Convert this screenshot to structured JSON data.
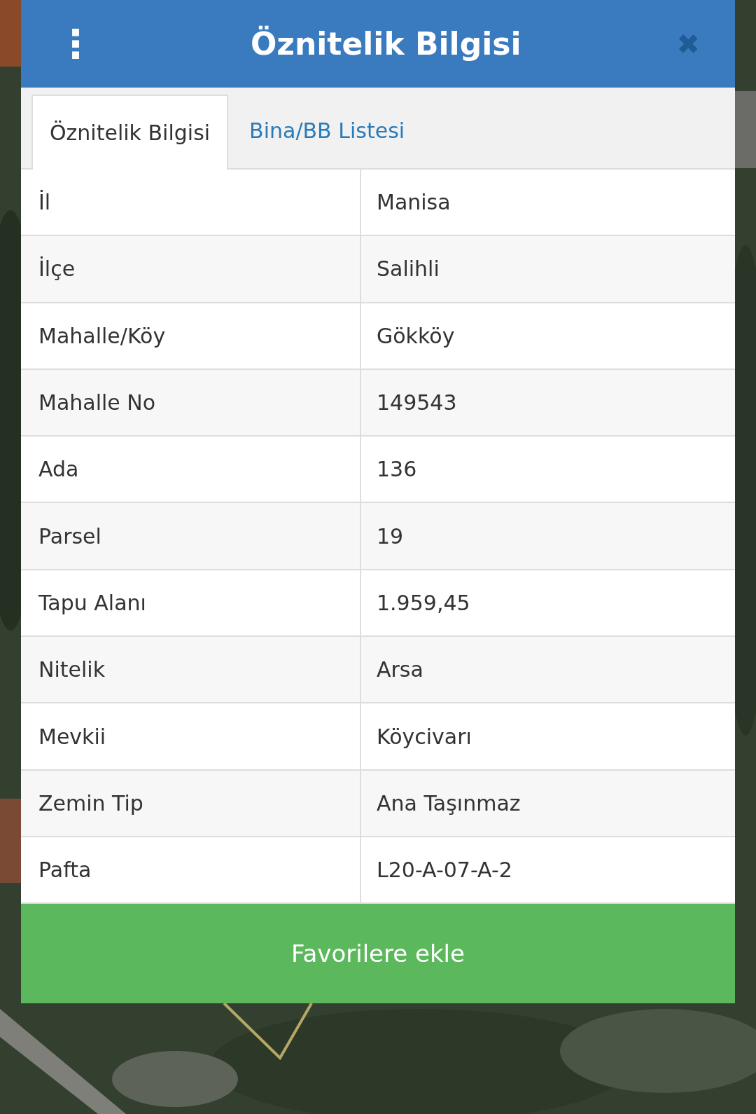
{
  "header": {
    "menu_icon": "⋮",
    "title": "Öznitelik Bilgisi",
    "close_icon": "✖"
  },
  "tabs": [
    {
      "label": "Öznitelik Bilgisi",
      "selected": true
    },
    {
      "label": "Bina/BB Listesi",
      "selected": false
    }
  ],
  "table": {
    "rows": [
      {
        "label": "İl",
        "value": "Manisa"
      },
      {
        "label": "İlçe",
        "value": "Salihli"
      },
      {
        "label": "Mahalle/Köy",
        "value": "Gökköy"
      },
      {
        "label": "Mahalle No",
        "value": "149543"
      },
      {
        "label": "Ada",
        "value": "136"
      },
      {
        "label": "Parsel",
        "value": "19"
      },
      {
        "label": "Tapu Alanı",
        "value": "1.959,45"
      },
      {
        "label": "Nitelik",
        "value": "Arsa"
      },
      {
        "label": "Mevkii",
        "value": "Köycivarı"
      },
      {
        "label": "Zemin Tip",
        "value": "Ana Taşınmaz"
      },
      {
        "label": "Pafta",
        "value": "L20-A-07-A-2"
      }
    ]
  },
  "button": "Favorilere ekle"
}
